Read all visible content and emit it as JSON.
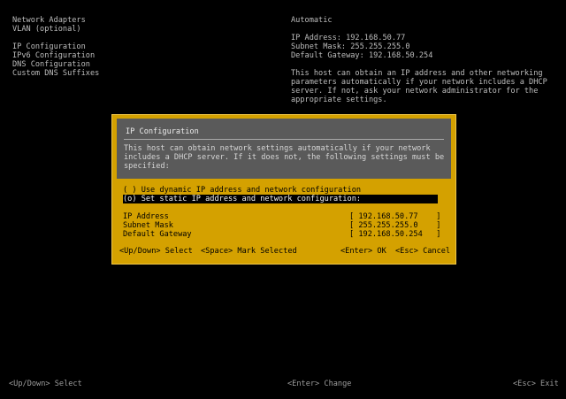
{
  "left_menu": {
    "items": [
      "Network Adapters",
      "VLAN (optional)",
      "IP Configuration",
      "IPv6 Configuration",
      "DNS Configuration",
      "Custom DNS Suffixes"
    ]
  },
  "right_panel": {
    "mode": "Automatic",
    "ip_address": "IP Address: 192.168.50.77",
    "subnet_mask": "Subnet Mask: 255.255.255.0",
    "default_gateway": "Default Gateway: 192.168.50.254",
    "description": [
      "This host can obtain an IP address and other networking",
      "parameters automatically if your network includes a DHCP",
      "server. If not, ask your network administrator for the",
      "appropriate settings."
    ]
  },
  "dialog": {
    "title": "IP Configuration",
    "description": [
      "This host can obtain network settings automatically if your network",
      "includes a DHCP server. If it does not, the following settings must be",
      "specified:"
    ],
    "option_dynamic": "( ) Use dynamic IP address and network configuration",
    "option_static": "(o) Set static IP address and network configuration:",
    "fields": {
      "ip_label": "IP Address",
      "ip_value": "[ 192.168.50.77    ]",
      "mask_label": "Subnet Mask",
      "mask_value": "[ 255.255.255.0    ]",
      "gateway_label": "Default Gateway",
      "gateway_value": "[ 192.168.50.254   ]"
    },
    "keys": {
      "updown_key": "<Up/Down>",
      "updown_action": "Select",
      "space_key": "<Space>",
      "space_action": "Mark Selected",
      "enter_key": "<Enter>",
      "enter_action": "OK",
      "esc_key": "<Esc>",
      "esc_action": "Cancel"
    }
  },
  "bottom_bar": {
    "left": "<Up/Down> Select",
    "middle": "<Enter> Change",
    "right": "<Esc> Exit"
  },
  "colors": {
    "background": "#000000",
    "dialog_yellow": "#d4a100",
    "dialog_title_gray": "#5a5a5a",
    "text_gray": "#bdbdbd",
    "selection_black": "#000000"
  }
}
